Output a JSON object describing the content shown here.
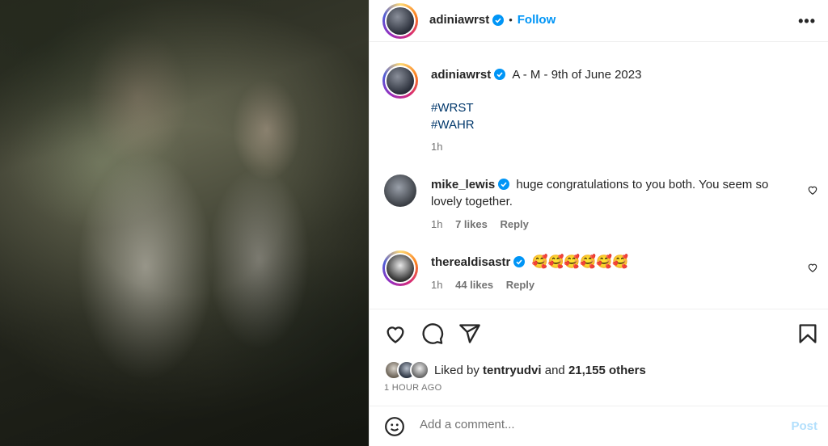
{
  "header": {
    "username": "adiniawrst",
    "separator": "•",
    "follow_label": "Follow",
    "more_label": "•••"
  },
  "caption": {
    "username": "adiniawrst",
    "text": "A - M - 9th of June 2023",
    "hashtags": [
      "#WRST",
      "#WAHR"
    ],
    "time": "1h"
  },
  "comments": [
    {
      "username": "mike_lewis",
      "text": "huge congratulations to you both. You seem so lovely together.",
      "time": "1h",
      "likes": "7 likes",
      "reply_label": "Reply"
    },
    {
      "username": "therealdisastr",
      "text": "🥰🥰🥰🥰🥰🥰",
      "time": "1h",
      "likes": "44 likes",
      "reply_label": "Reply"
    }
  ],
  "likes": {
    "prefix": "Liked by",
    "user": "tentryudvi",
    "middle": "and",
    "others": "21,155 others"
  },
  "time_ago": "1 HOUR AGO",
  "comment_box": {
    "placeholder": "Add a comment...",
    "post_label": "Post"
  },
  "colors": {
    "accent": "#0095f6",
    "verified": "#0095f6",
    "post_disabled": "#b2dffc"
  },
  "icons": [
    "more-icon",
    "verified-icon",
    "heart-icon",
    "comment-icon",
    "share-icon",
    "save-icon",
    "emoji-icon"
  ]
}
